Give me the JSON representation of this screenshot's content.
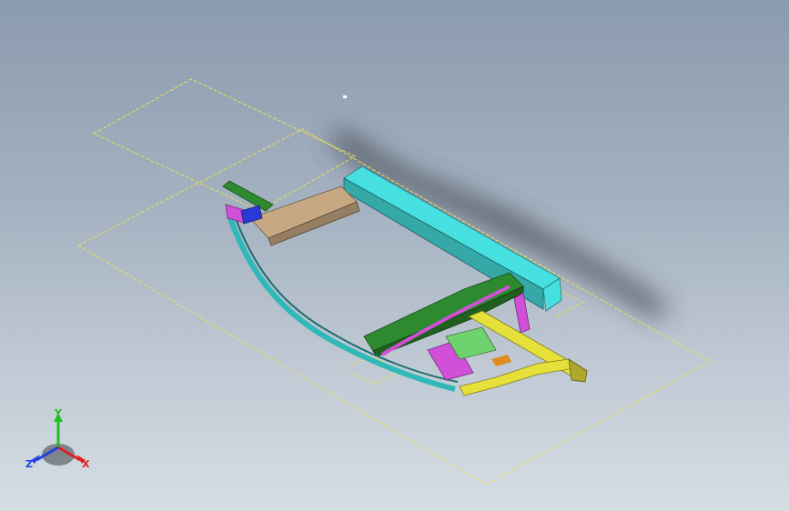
{
  "viewport": {
    "background_top": "#8b9bae",
    "background_bottom": "#d6dde4"
  },
  "sketch_color": "#e8e05a",
  "part_colors": {
    "rear_crossmember": "#46e0e0",
    "front_crossmember": "#2e8a2e",
    "bracket": "#c8a882",
    "side_rail": "#2fb8b8",
    "hinge_bracket": "#d050d8",
    "front_bumper": "#e6e03a",
    "mount_plate": "#6ed26e",
    "small_block": "#2a3ad8",
    "shadow": "#3c4148"
  },
  "triad": {
    "icon": "coordinate-triad-icon",
    "x_label": "X",
    "y_label": "Y",
    "z_label": "Z",
    "x_color": "#e02020",
    "y_color": "#20c020",
    "z_color": "#2040e0"
  }
}
